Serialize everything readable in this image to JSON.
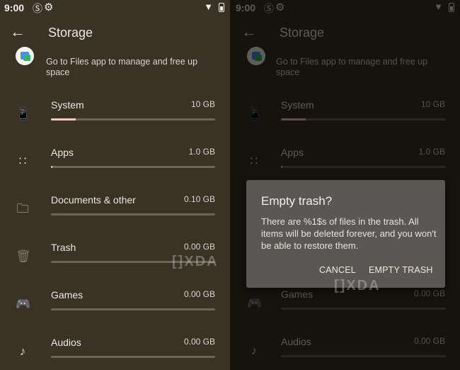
{
  "status": {
    "time": "9:00"
  },
  "appbar": {
    "title": "Storage"
  },
  "files_banner": {
    "text": "Go to Files app to manage and free up space"
  },
  "rows": [
    {
      "label": "System",
      "size": "10 GB",
      "fraction": 0.15
    },
    {
      "label": "Apps",
      "size": "1.0 GB",
      "fraction": 0.01
    },
    {
      "label": "Documents & other",
      "size": "0.10 GB",
      "fraction": 0.0
    },
    {
      "label": "Trash",
      "size": "0.00 GB",
      "fraction": 0.0
    },
    {
      "label": "Games",
      "size": "0.00 GB",
      "fraction": 0.0
    },
    {
      "label": "Audios",
      "size": "0.00 GB",
      "fraction": 0.0
    }
  ],
  "dialog": {
    "title": "Empty trash?",
    "body": "There are %1$s of files in the trash. All items will be deleted forever, and you won't be able to restore them.",
    "cancel_label": "CANCEL",
    "confirm_label": "EMPTY TRASH"
  },
  "watermark": "[]XDA",
  "colors": {
    "background": "#3a3325",
    "bar_track": "#6e6654",
    "bar_fill": "#f3c9c3",
    "dialog": "#5a5854"
  },
  "icons": {
    "back": "arrow-back-icon",
    "system": "phone-download-icon",
    "apps": "apps-grid-icon",
    "documents": "folder-icon",
    "trash": "trash-icon",
    "games": "gamepad-icon",
    "audios": "music-note-icon"
  }
}
